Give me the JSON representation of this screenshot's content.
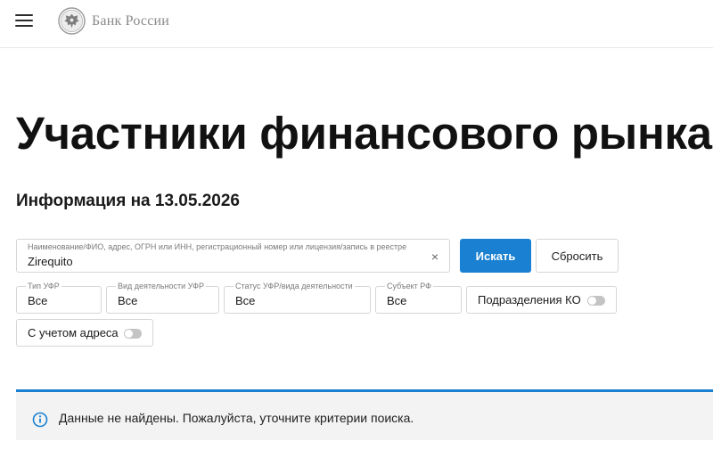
{
  "header": {
    "menu_icon": "hamburger-menu-icon",
    "logo_icon": "bank-of-russia-emblem-icon",
    "logo_text": "Банк России"
  },
  "main": {
    "title": "Участники финансового рынка",
    "info_date": "Информация на 13.05.2026"
  },
  "search": {
    "label": "Наименование/ФИО, адрес, ОГРН или ИНН, регистрационный номер или лицензия/запись в реестре",
    "value": "Zirequito",
    "clear_symbol": "×",
    "submit_label": "Искать",
    "reset_label": "Сбросить"
  },
  "filters": {
    "type": {
      "label": "Тип УФР",
      "value": "Все"
    },
    "activity": {
      "label": "Вид деятельности УФР",
      "value": "Все"
    },
    "status": {
      "label": "Статус УФР/вида деятельности",
      "value": "Все"
    },
    "subject": {
      "label": "Субъект РФ",
      "value": "Все"
    },
    "divisions_toggle": {
      "label": "Подразделения КО",
      "on": false
    },
    "address_toggle": {
      "label": "С учетом адреса",
      "on": false
    }
  },
  "notice": {
    "icon": "info-icon",
    "text": "Данные не найдены. Пожалуйста, уточните критерии поиска.",
    "accent_color": "#1a80d1"
  },
  "colors": {
    "primary": "#1a80d1",
    "notice_bg": "#f3f3f3"
  }
}
